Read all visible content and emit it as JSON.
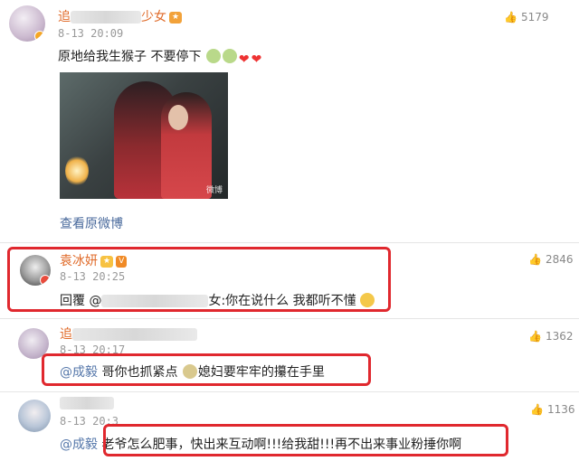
{
  "comments": [
    {
      "name_prefix": "追",
      "name_suffix": "少女",
      "time": "8-13 20:09",
      "likes": "5179",
      "text": "原地给我生猴子 不要停下",
      "image_watermark": "微博",
      "view_original": "查看原微博"
    },
    {
      "name": "袁冰妍",
      "time": "8-13 20:25",
      "likes": "2846",
      "reply_prefix": "回覆 @",
      "reply_suffix": "女:你在说什么 我都听不懂"
    },
    {
      "name_prefix": "追",
      "time": "8-13 20:17",
      "likes": "1362",
      "mention": "@成毅",
      "text_a": "哥你也抓紧点",
      "text_b": "媳妇要牢牢的攥在手里"
    },
    {
      "time": "8-13 20:3",
      "likes": "1136",
      "mention": "@成毅",
      "text": "老爷怎么肥事，快出来互动啊!!!给我甜!!!再不出来事业粉捶你啊"
    }
  ],
  "colors": {
    "highlight_box": "#e0282e",
    "username": "#e06b2a",
    "mention": "#5577aa"
  }
}
